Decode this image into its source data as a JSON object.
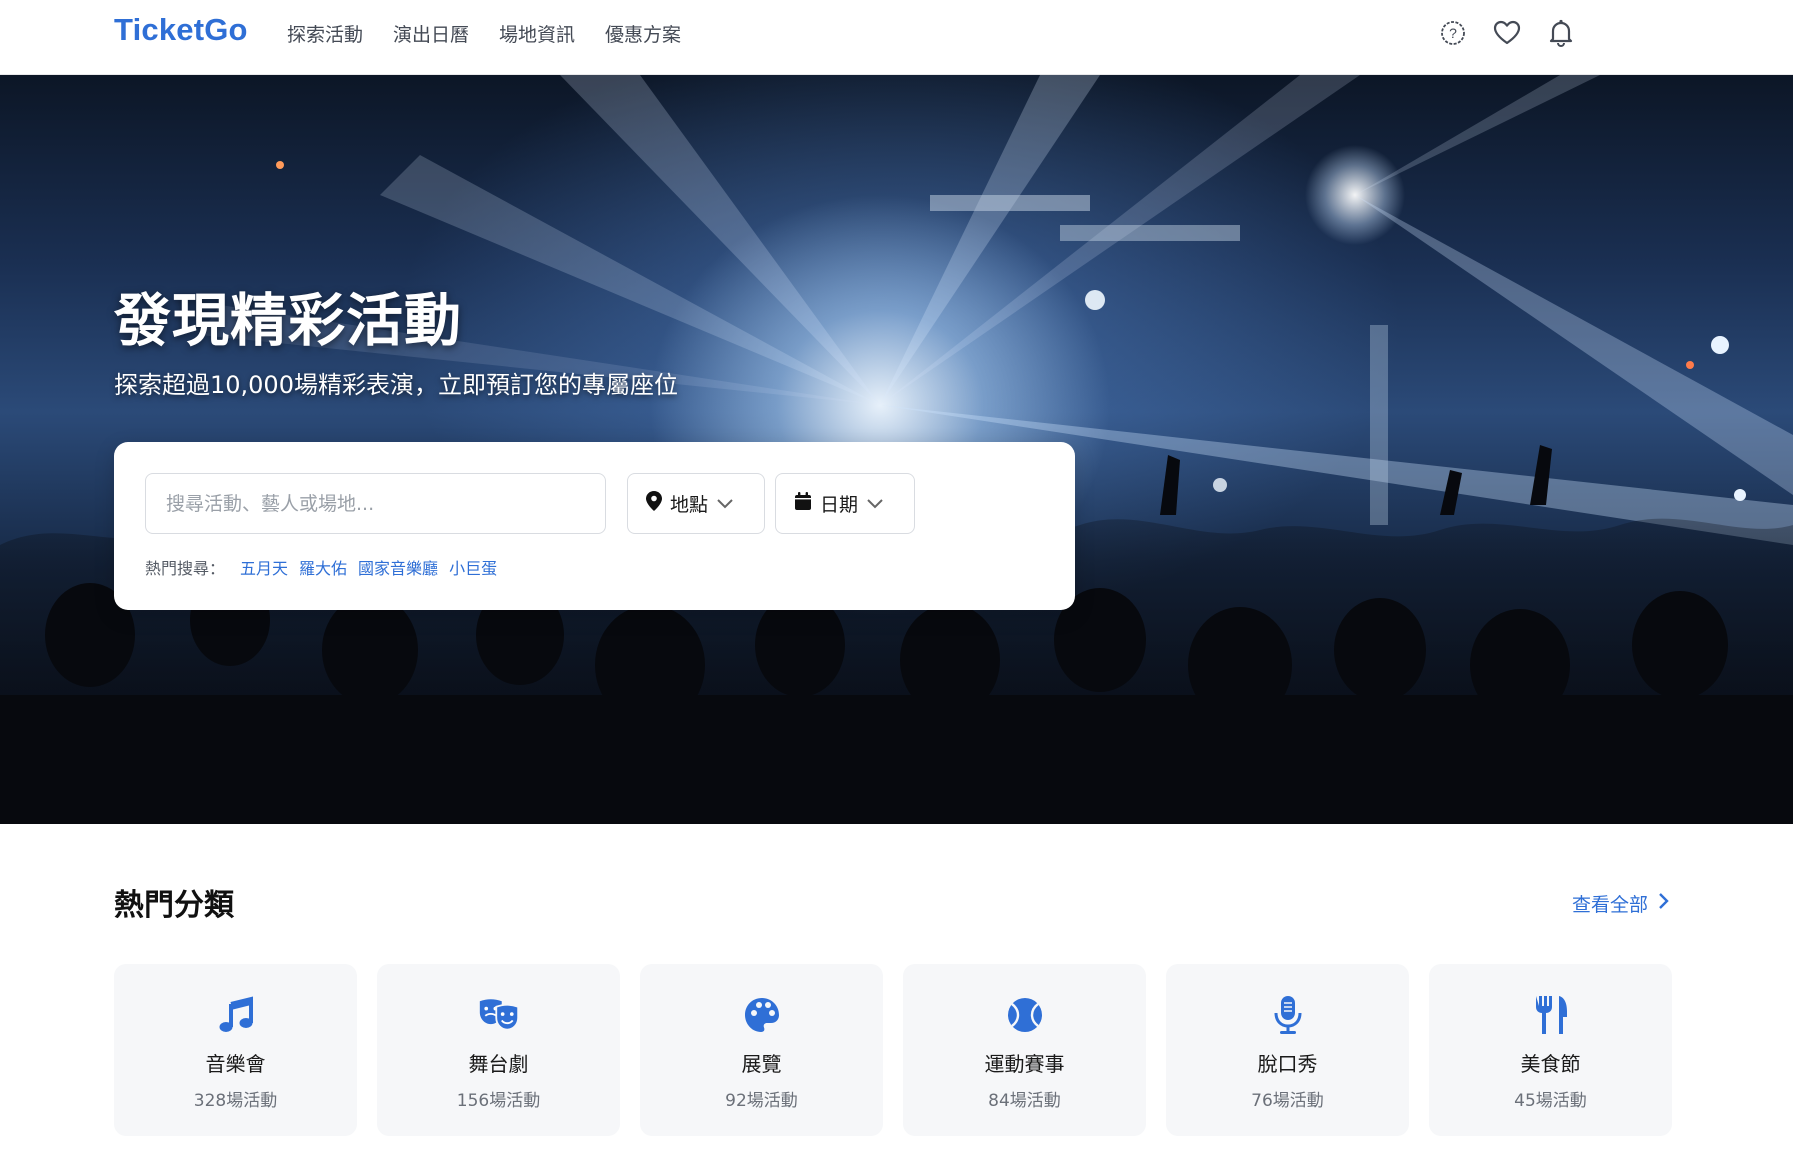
{
  "header": {
    "logo": "TicketGo",
    "nav": [
      "探索活動",
      "演出日曆",
      "場地資訊",
      "優惠方案"
    ]
  },
  "hero": {
    "title": "發現精彩活動",
    "subtitle": "探索超過10,000場精彩表演，立即預訂您的專屬座位"
  },
  "search": {
    "placeholder": "搜尋活動、藝人或場地...",
    "location_label": "地點",
    "date_label": "日期",
    "hot_label": "熱門搜尋：",
    "hot_tags": [
      "五月天",
      "羅大佑",
      "國家音樂廳",
      "小巨蛋"
    ]
  },
  "categories": {
    "title": "熱門分類",
    "view_all": "查看全部",
    "items": [
      {
        "name": "音樂會",
        "count": "328場活動",
        "icon": "music-note-icon"
      },
      {
        "name": "舞台劇",
        "count": "156場活動",
        "icon": "theater-masks-icon"
      },
      {
        "name": "展覽",
        "count": "92場活動",
        "icon": "palette-icon"
      },
      {
        "name": "運動賽事",
        "count": "84場活動",
        "icon": "ball-icon"
      },
      {
        "name": "脫口秀",
        "count": "76場活動",
        "icon": "microphone-icon"
      },
      {
        "name": "美食節",
        "count": "45場活動",
        "icon": "fork-knife-icon"
      }
    ]
  },
  "colors": {
    "accent": "#2f6fd6",
    "card_bg": "#f6f7f9"
  }
}
